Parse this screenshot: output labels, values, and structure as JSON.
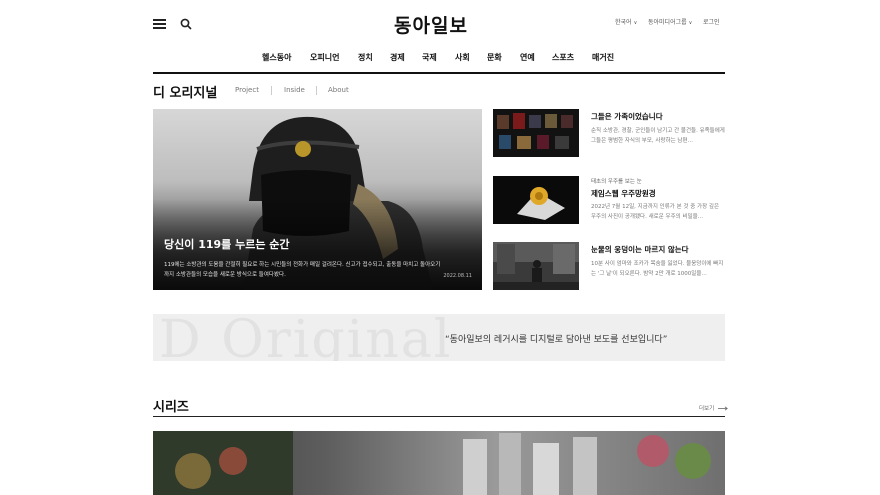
{
  "header": {
    "logo": "동아일보",
    "util": [
      {
        "label": "한국어",
        "caret": "∨"
      },
      {
        "label": "동아미디어그룹",
        "caret": "∨"
      },
      {
        "label": "로그인",
        "caret": ""
      }
    ]
  },
  "gnb": [
    "헬스동아",
    "오피니언",
    "정치",
    "경제",
    "국제",
    "사회",
    "문화",
    "연예",
    "스포츠",
    "매거진"
  ],
  "section": {
    "title": "디 오리지널",
    "subnav": [
      "Project",
      "Inside",
      "About"
    ]
  },
  "hero": {
    "headline": "당신이 119를 누르는 순간",
    "summary": "119에는 소방관의 도움을 간절히 필요로 하는 시민들의 전화가 매일 걸려온다. 신고가 접수되고, 출동을 마치고 돌아오기까지 소방관들의 모습을 새로운 방식으로 들여다봤다.",
    "date": "2022.08.11"
  },
  "side_articles": [
    {
      "kicker": "",
      "title": "그들은 가족이었습니다",
      "desc": "순직 소방관, 경찰, 군인들이 남기고 간 물건들. 유족들에게 그들은 평범한 자식의 부모, 사랑하는 남편…"
    },
    {
      "kicker": "태초의 우주를 보는 눈",
      "title": "제임스웹 우주망원경",
      "desc": "2022년 7월 12일, 지금까지 인류가 본 것 중 가장 깊은 우주의 사진이 공개됐다. 새로운 우주의 비밀을…"
    },
    {
      "kicker": "",
      "title": "눈물의 웅덩이는 마르지 않는다",
      "desc": "10분 사이 엄마와 조카가 목숨을 잃었다. 물웅덩이에 빠지는 '그 날'이 되오른다. 밤약 2만 개로 1000일을…"
    }
  ],
  "banner": {
    "background_text": "D Original",
    "quote": "“동아일보의 레거시를 디지털로 담아낸 보도를 선보입니다”"
  },
  "series": {
    "title": "시리즈",
    "more": "더보기"
  }
}
